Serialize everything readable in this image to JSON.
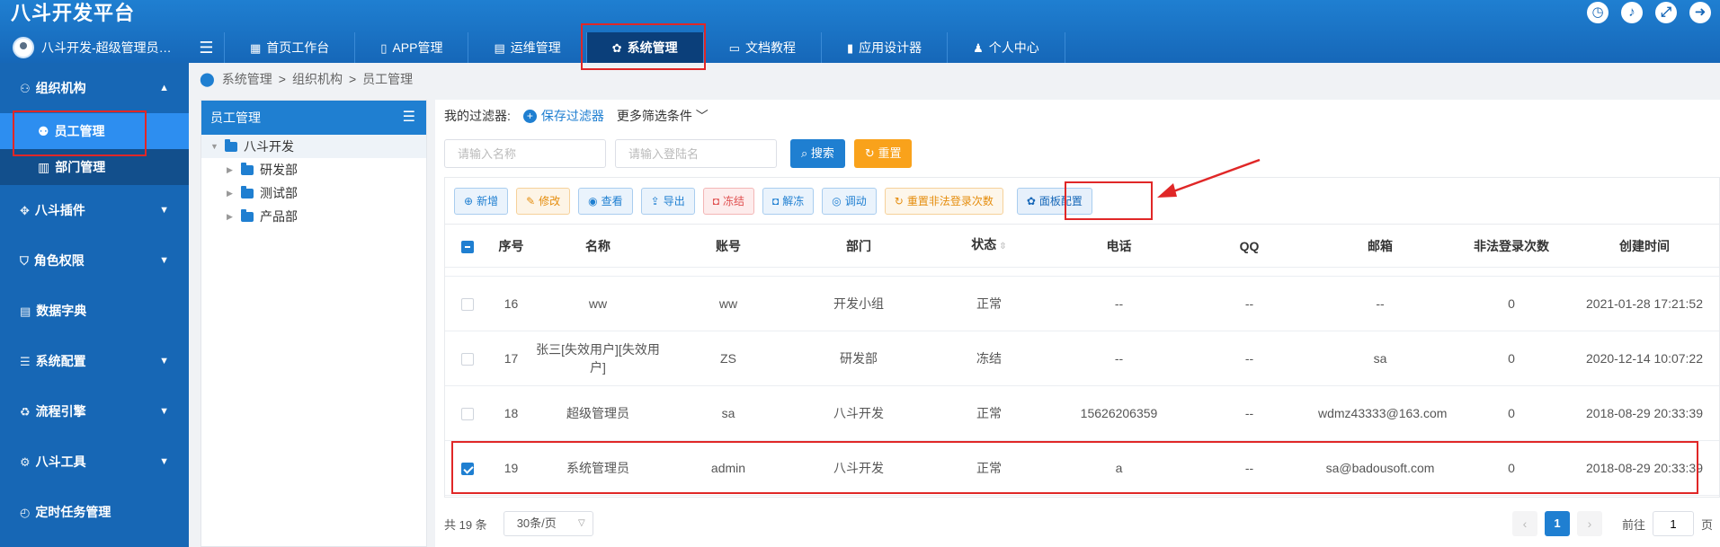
{
  "app": {
    "title": "八斗开发平台"
  },
  "user": {
    "name": "八斗开发-超级管理员…"
  },
  "header_icons": [
    "clock-icon",
    "bell-icon",
    "fullscreen-icon",
    "logout-icon"
  ],
  "nav": {
    "toggle": "☰",
    "tabs": [
      {
        "label": "首页工作台",
        "icon": "home-icon"
      },
      {
        "label": "APP管理",
        "icon": "mobile-icon"
      },
      {
        "label": "运维管理",
        "icon": "doc-icon"
      },
      {
        "label": "系统管理",
        "icon": "gear-icon",
        "active": true
      },
      {
        "label": "文档教程",
        "icon": "book-icon"
      },
      {
        "label": "应用设计器",
        "icon": "design-icon"
      },
      {
        "label": "个人中心",
        "icon": "user-icon"
      }
    ]
  },
  "sidebar": {
    "groups": [
      {
        "label": "组织机构",
        "expanded": true
      },
      {
        "label": "八斗插件"
      },
      {
        "label": "角色权限"
      },
      {
        "label": "数据字典"
      },
      {
        "label": "系统配置"
      },
      {
        "label": "流程引擎"
      },
      {
        "label": "八斗工具"
      },
      {
        "label": "定时任务管理"
      }
    ],
    "subitems": [
      {
        "label": "员工管理",
        "active": true
      },
      {
        "label": "部门管理"
      }
    ]
  },
  "breadcrumb": [
    "系统管理",
    "组织机构",
    "员工管理"
  ],
  "tree": {
    "title": "员工管理",
    "root": "八斗开发",
    "children": [
      "研发部",
      "测试部",
      "产品部"
    ]
  },
  "filters": {
    "label": "我的过滤器:",
    "save": "保存过滤器",
    "more": "更多筛选条件",
    "name_placeholder": "请输入名称",
    "login_placeholder": "请输入登陆名",
    "search": "搜索",
    "reset": "重置"
  },
  "toolbar": {
    "add": "新增",
    "edit": "修改",
    "view": "查看",
    "export": "导出",
    "freeze": "冻结",
    "unfreeze": "解冻",
    "transfer": "调动",
    "reset_login": "重置非法登录次数",
    "panel_config": "面板配置"
  },
  "table": {
    "headers": [
      "序号",
      "名称",
      "账号",
      "部门",
      "状态",
      "电话",
      "QQ",
      "邮箱",
      "非法登录次数",
      "创建时间"
    ],
    "rows": [
      {
        "no": "16",
        "name": "ww",
        "account": "ww",
        "dept": "开发小组",
        "status": "正常",
        "phone": "--",
        "qq": "--",
        "email": "--",
        "illegal": "0",
        "created": "2021-01-28 17:21:52",
        "checked": false
      },
      {
        "no": "17",
        "name": "张三[失效用户][失效用户]",
        "account": "ZS",
        "dept": "研发部",
        "status": "冻结",
        "phone": "--",
        "qq": "--",
        "email": "sa",
        "illegal": "0",
        "created": "2020-12-14 10:07:22",
        "checked": false
      },
      {
        "no": "18",
        "name": "超级管理员",
        "account": "sa",
        "dept": "八斗开发",
        "status": "正常",
        "phone": "15626206359",
        "qq": "--",
        "email": "wdmz43333@163.com",
        "illegal": "0",
        "created": "2018-08-29 20:33:39",
        "checked": false
      },
      {
        "no": "19",
        "name": "系统管理员",
        "account": "admin",
        "dept": "八斗开发",
        "status": "正常",
        "phone": "a",
        "qq": "--",
        "email": "sa@badousoft.com",
        "illegal": "0",
        "created": "2018-08-29 20:33:39",
        "checked": true
      }
    ]
  },
  "pagination": {
    "total": "共 19 条",
    "page_size": "30条/页",
    "prev": "‹",
    "current": "1",
    "next": "›",
    "goto_label": "前往",
    "goto_value": "1",
    "page_unit": "页"
  }
}
